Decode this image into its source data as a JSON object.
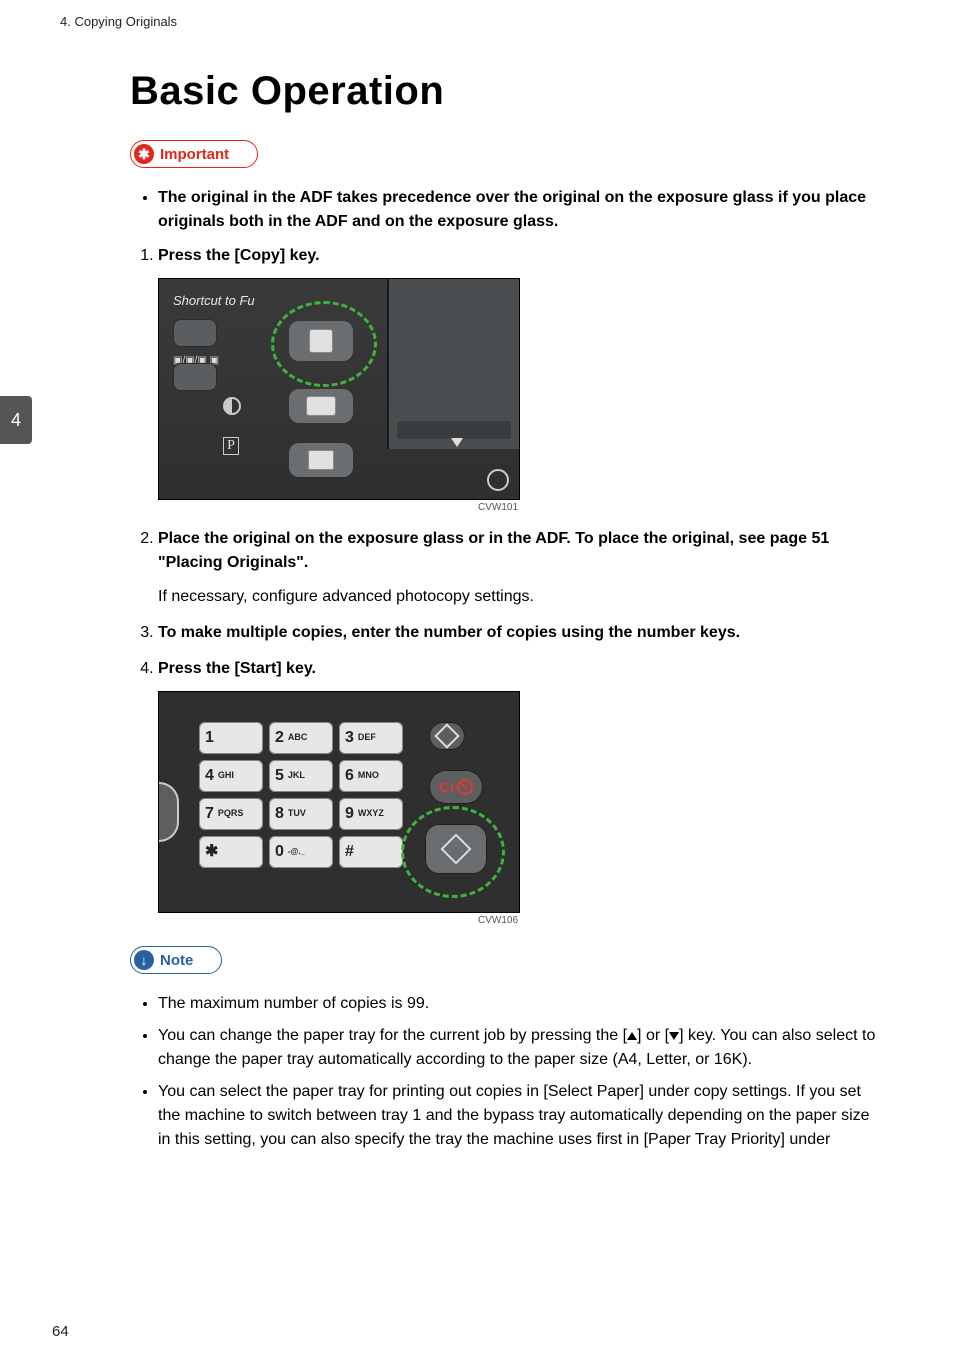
{
  "running_head": "4. Copying Originals",
  "chapter_tab": "4",
  "page_number": "64",
  "title": "Basic Operation",
  "callouts": {
    "important_label": "Important",
    "note_label": "Note"
  },
  "important_bullets": [
    "The original in the ADF takes precedence over the original on the exposure glass if you place originals both in the ADF and on the exposure glass."
  ],
  "steps": [
    {
      "main": "Press the [Copy] key.",
      "fig_caption": "CVW101"
    },
    {
      "main": "Place the original on the exposure glass or in the ADF. To place the original, see page 51 \"Placing Originals\".",
      "sub": "If necessary, configure advanced photocopy settings."
    },
    {
      "main": "To make multiple copies, enter the number of copies using the number keys."
    },
    {
      "main": "Press the [Start] key.",
      "fig_caption": "CVW106"
    }
  ],
  "fig1": {
    "shortcut_label": "Shortcut to Fu"
  },
  "fig2": {
    "keys": [
      {
        "num": "1",
        "letters": ""
      },
      {
        "num": "2",
        "letters": "ABC"
      },
      {
        "num": "3",
        "letters": "DEF"
      },
      {
        "num": "4",
        "letters": "GHI"
      },
      {
        "num": "5",
        "letters": "JKL"
      },
      {
        "num": "6",
        "letters": "MNO"
      },
      {
        "num": "7",
        "letters": "PQRS"
      },
      {
        "num": "8",
        "letters": "TUV"
      },
      {
        "num": "9",
        "letters": "WXYZ"
      },
      {
        "num": "✱",
        "letters": ""
      },
      {
        "num": "0",
        "letters": "-@._"
      },
      {
        "num": "#",
        "letters": ""
      }
    ],
    "clear_label": "C/"
  },
  "note_bullets": {
    "b1": "The maximum number of copies is 99.",
    "b2_a": "You can change the paper tray for the current job by pressing the [",
    "b2_b": "] or [",
    "b2_c": "] key. You can also select to change the paper tray automatically according to the paper size (A4, Letter, or 16K).",
    "b3": "You can select the paper tray for printing out copies in [Select Paper] under copy settings. If you set the machine to switch between tray 1 and the bypass tray automatically depending on the paper size in this setting, you can also specify the tray the machine uses first in [Paper Tray Priority] under"
  }
}
